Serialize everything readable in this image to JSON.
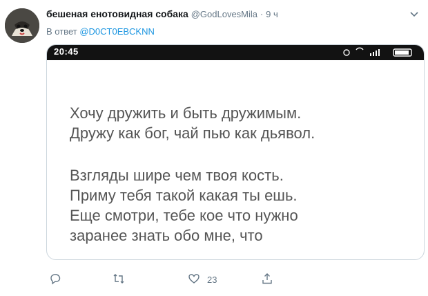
{
  "tweet": {
    "author_name": "бешеная енотовидная собака",
    "author_handle": "@GodLovesMila",
    "separator": "·",
    "time": "9 ч",
    "reply_prefix": "В ответ",
    "reply_to": "@D0CT0EBCKNN"
  },
  "image": {
    "status_time": "20:45",
    "lines": [
      "Хочу дружить и быть дружимым.",
      "Дружу как бог, чай пью как дьявол.",
      "Взгляды шире чем твоя кость.",
      "Приму тебя такой какая ты ешь.",
      "Еще смотри, тебе кое что нужно",
      "заранее знать обо мне, что"
    ]
  },
  "actions": {
    "reply_count": "",
    "retweet_count": "",
    "like_count": "23"
  },
  "colors": {
    "accent": "#1b95e0",
    "secondary_text": "#657786"
  }
}
